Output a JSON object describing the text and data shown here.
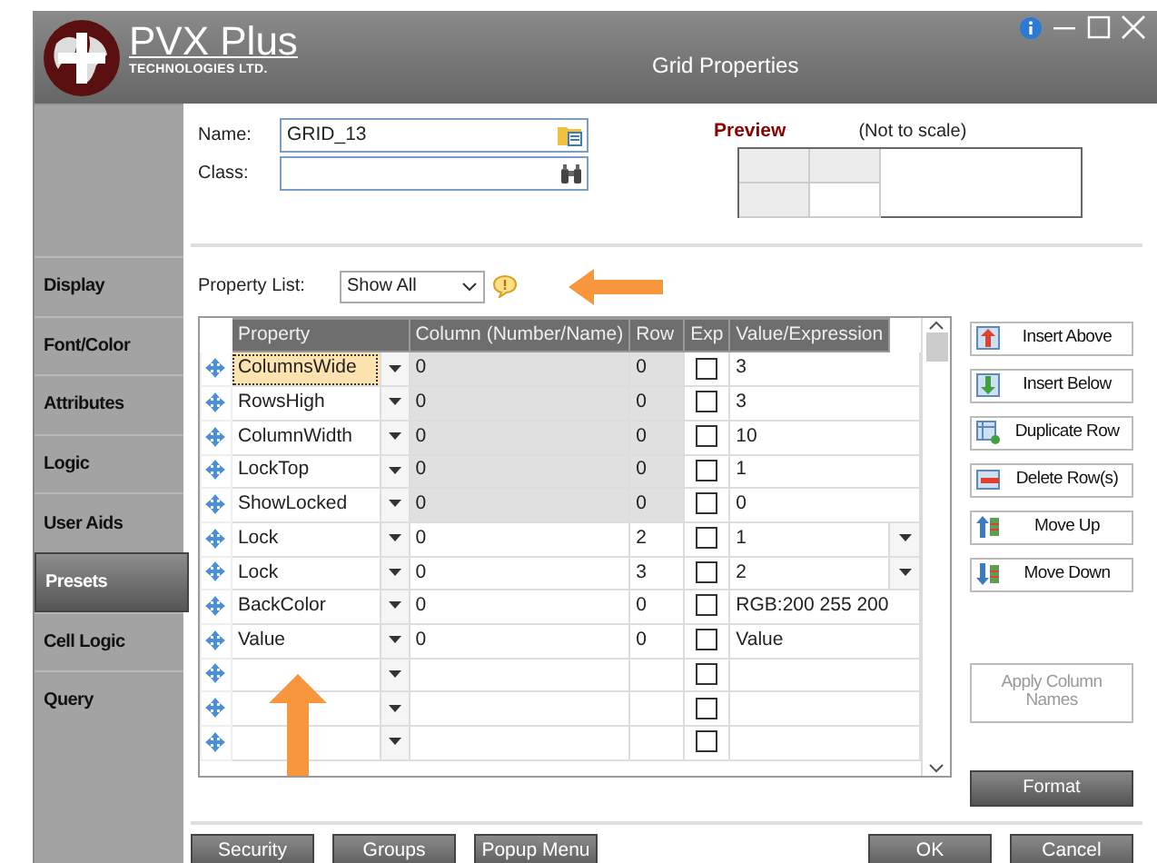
{
  "window": {
    "title": "Grid Properties"
  },
  "logo": {
    "name": "PVX Plus",
    "subtitle": "TECHNOLOGIES LTD."
  },
  "sidebar": {
    "items": [
      {
        "label": "Display",
        "selected": false
      },
      {
        "label": "Font/Color",
        "selected": false
      },
      {
        "label": "Attributes",
        "selected": false
      },
      {
        "label": "Logic",
        "selected": false
      },
      {
        "label": "User Aids",
        "selected": false
      },
      {
        "label": "Presets",
        "selected": true
      },
      {
        "label": "Cell Logic",
        "selected": false
      },
      {
        "label": "Query",
        "selected": false
      }
    ]
  },
  "name_field": {
    "label": "Name:",
    "value": "GRID_13"
  },
  "class_field": {
    "label": "Class:"
  },
  "preview": {
    "label": "Preview",
    "note": "(Not to scale)"
  },
  "property_list": {
    "label": "Property List:",
    "value": "Show All"
  },
  "grid": {
    "columns": [
      "Property",
      "Column (Number/Name)",
      "Row",
      "Exp",
      "Value/Expression"
    ],
    "rows": [
      {
        "property": "ColumnsWide",
        "column": "0",
        "row": "0",
        "exp_checked": false,
        "value": "3",
        "locked": true,
        "selected": true,
        "kind": "text"
      },
      {
        "property": "RowsHigh",
        "column": "0",
        "row": "0",
        "exp_checked": false,
        "value": "3",
        "locked": true,
        "selected": false,
        "kind": "text"
      },
      {
        "property": "ColumnWidth",
        "column": "0",
        "row": "0",
        "exp_checked": false,
        "value": "10",
        "locked": true,
        "selected": false,
        "kind": "text"
      },
      {
        "property": "LockTop",
        "column": "0",
        "row": "0",
        "exp_checked": false,
        "value": "1",
        "locked": true,
        "selected": false,
        "kind": "text"
      },
      {
        "property": "ShowLocked",
        "column": "0",
        "row": "0",
        "exp_checked": false,
        "value": "0",
        "locked": true,
        "selected": false,
        "kind": "text"
      },
      {
        "property": "Lock",
        "column": "0",
        "row": "2",
        "exp_checked": false,
        "value": "1",
        "locked": false,
        "selected": false,
        "kind": "dropdown"
      },
      {
        "property": "Lock",
        "column": "0",
        "row": "3",
        "exp_checked": false,
        "value": "2",
        "locked": false,
        "selected": false,
        "kind": "dropdown"
      },
      {
        "property": "BackColor",
        "column": "0",
        "row": "0",
        "exp_checked": false,
        "value": "RGB:200 255 200",
        "locked": false,
        "selected": false,
        "kind": "text"
      },
      {
        "property": "Value",
        "column": "0",
        "row": "0",
        "exp_checked": false,
        "value": "Value",
        "locked": false,
        "selected": false,
        "kind": "text"
      },
      {
        "exp_checked": false,
        "locked": false,
        "selected": false,
        "kind": "text"
      },
      {
        "exp_checked": false,
        "locked": false,
        "selected": false,
        "kind": "text"
      },
      {
        "exp_checked": false,
        "locked": false,
        "selected": false,
        "kind": "text"
      }
    ]
  },
  "side_buttons": [
    {
      "label": "Insert Above",
      "kind": "insert-above",
      "disabled": false
    },
    {
      "label": "Insert Below",
      "kind": "insert-below",
      "disabled": false
    },
    {
      "label": "Duplicate Row",
      "kind": "duplicate",
      "disabled": false
    },
    {
      "label": "Delete Row(s)",
      "kind": "delete",
      "disabled": false
    },
    {
      "label": "Move Up",
      "kind": "move-up",
      "disabled": false
    },
    {
      "label": "Move Down",
      "kind": "move-down",
      "disabled": false
    },
    {
      "label": "Apply Column Names",
      "kind": "plain",
      "disabled": true
    }
  ],
  "format_button": {
    "label": "Format"
  },
  "bottom_buttons_left": [
    "Security",
    "Groups",
    "Popup Menu"
  ],
  "bottom_buttons_right": [
    "OK",
    "Cancel"
  ]
}
